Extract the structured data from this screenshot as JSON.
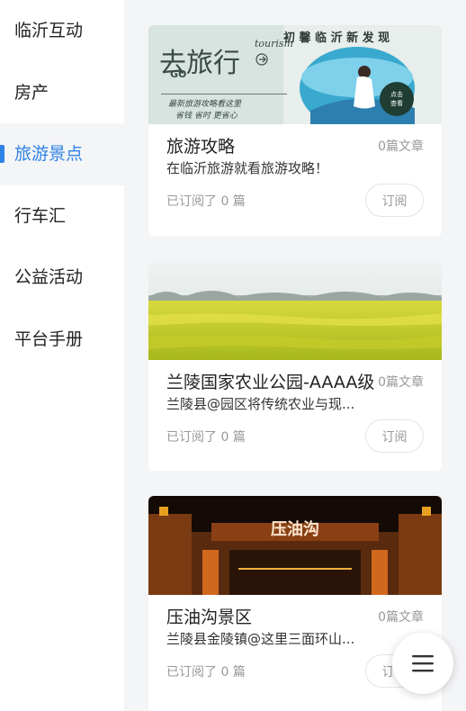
{
  "sidebar": {
    "items": [
      {
        "label": "临沂互动",
        "active": false
      },
      {
        "label": "房产",
        "active": false
      },
      {
        "label": "旅游景点",
        "active": true
      },
      {
        "label": "行车汇",
        "active": false
      },
      {
        "label": "公益活动",
        "active": false
      },
      {
        "label": "平台手册",
        "active": false
      }
    ]
  },
  "banner": {
    "headline": "初 馨 临 沂 新 发 现",
    "big_text": "去旅行",
    "go": "GO",
    "tourism": "tourism",
    "line1": "最新旅游攻略看这里",
    "line2": "省钱  省时  更省心",
    "badge": "点击查看"
  },
  "cards": [
    {
      "title": "旅游攻略",
      "count": "0篇文章",
      "desc": "在临沂旅游就看旅游攻略！",
      "subscribed": "已订阅了 0 篇",
      "button": "订阅"
    },
    {
      "title": "兰陵国家农业公园-AAAA级",
      "count": "0篇文章",
      "desc": "兰陵县@园区将传统农业与现...",
      "subscribed": "已订阅了 0 篇",
      "button": "订阅"
    },
    {
      "title": "压油沟景区",
      "count": "0篇文章",
      "desc": "兰陵县金陵镇@这里三面环山...",
      "subscribed": "已订阅了 0 篇",
      "button": "订阅"
    }
  ],
  "gate_sign": "压油沟",
  "fab": {
    "icon": "menu-icon"
  },
  "colors": {
    "accent": "#2f82e6",
    "background": "#f4f5f7"
  }
}
